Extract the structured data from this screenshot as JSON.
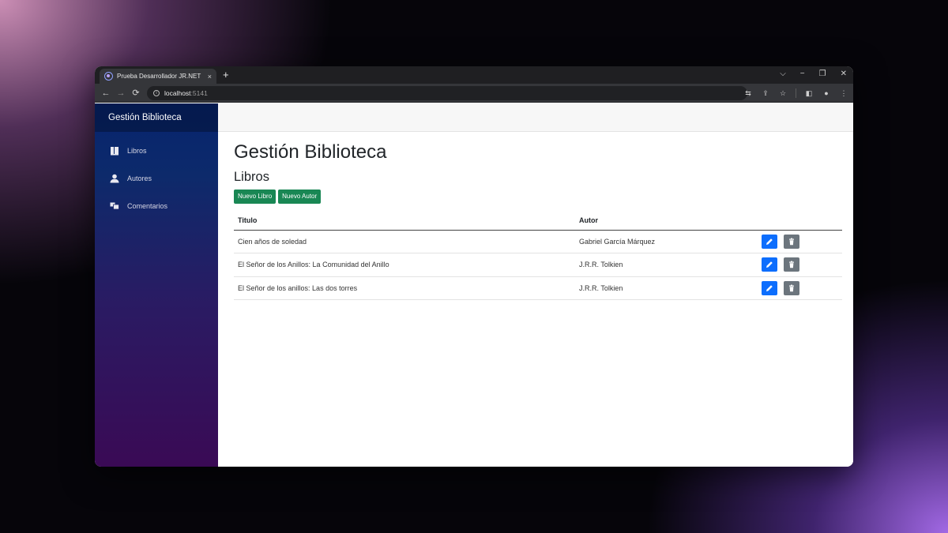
{
  "browser": {
    "tab_title": "Prueba Desarrollador JR.NET",
    "tab_close": "×",
    "new_tab": "+",
    "url_host": "localhost",
    "url_port": ":5141",
    "window_controls": [
      "⌵",
      "−",
      "❐",
      "✕"
    ]
  },
  "sidebar": {
    "brand": "Gestión Biblioteca",
    "items": [
      {
        "label": "Libros",
        "icon": "book-icon"
      },
      {
        "label": "Autores",
        "icon": "person-icon"
      },
      {
        "label": "Comentarios",
        "icon": "comments-icon"
      }
    ]
  },
  "main": {
    "title": "Gestión Biblioteca",
    "subtitle": "Libros",
    "buttons": {
      "new_book": "Nuevo Libro",
      "new_author": "Nuevo Autor"
    },
    "table": {
      "headers": [
        "Titulo",
        "Autor"
      ],
      "rows": [
        {
          "title": "Cien años de soledad",
          "author": "Gabriel García Márquez"
        },
        {
          "title": "El Señor de los Anillos: La Comunidad del Anillo",
          "author": "J.R.R. Tolkien"
        },
        {
          "title": "El Señor de los anillos: Las dos torres",
          "author": "J.R.R. Tolkien"
        }
      ]
    }
  },
  "colors": {
    "primary": "#0d6efd",
    "success": "#198754",
    "secondary": "#6c757d"
  }
}
